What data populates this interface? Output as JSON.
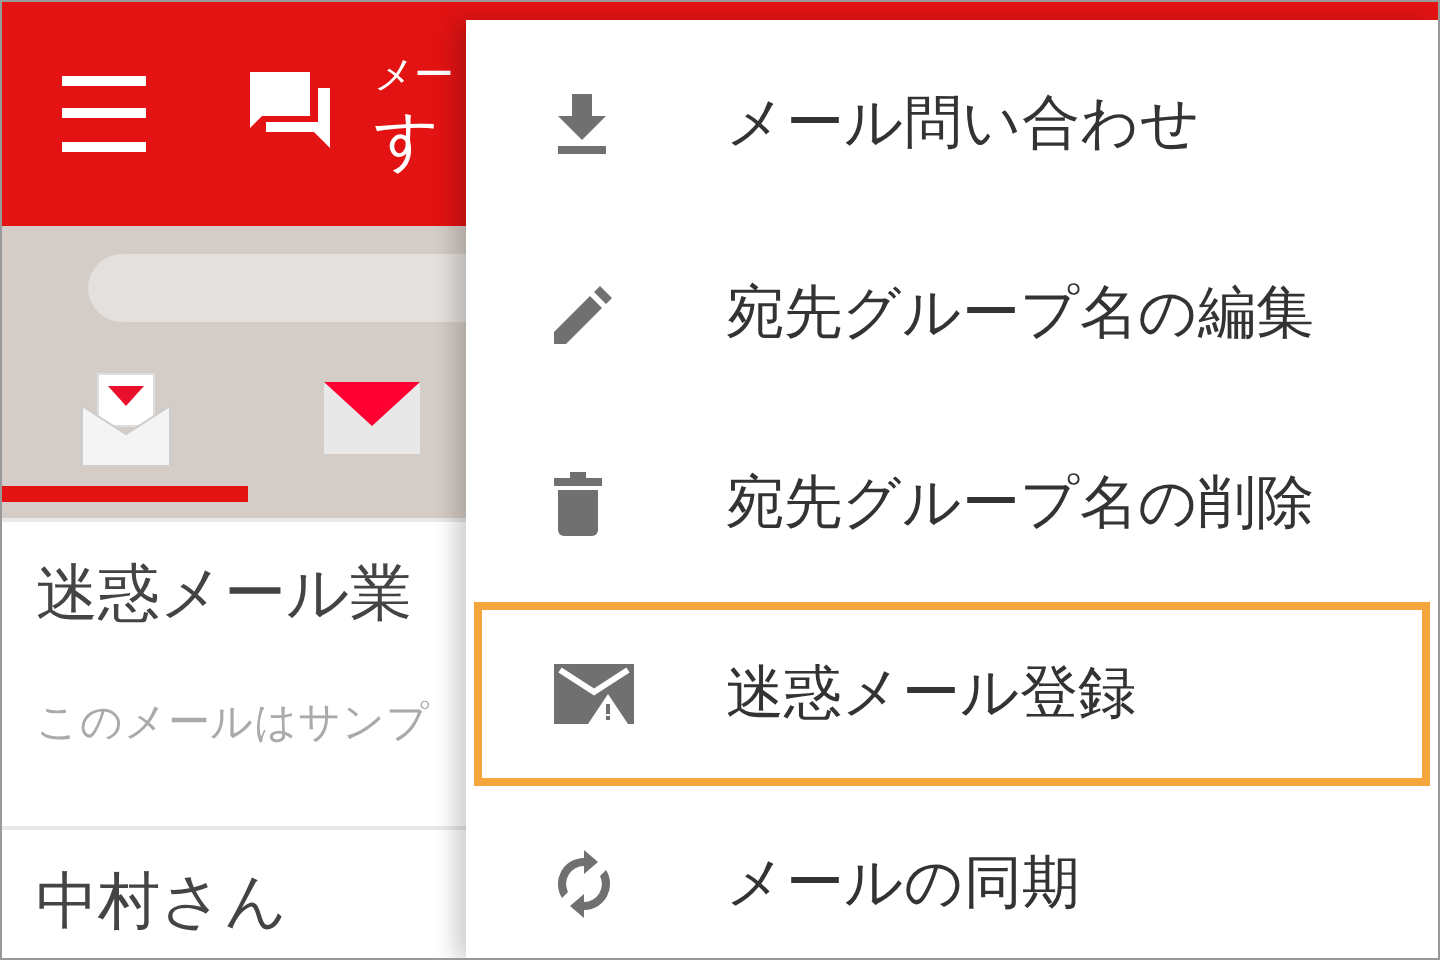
{
  "header": {
    "subtitle": "メー",
    "title": "す"
  },
  "tabs": [
    {
      "kind": "ymobile",
      "selected": true
    },
    {
      "kind": "mail",
      "selected": false
    }
  ],
  "messages": [
    {
      "sender": "迷惑メール業",
      "preview": "このメールはサンプ"
    },
    {
      "sender": "中村さん"
    }
  ],
  "menu": [
    {
      "kind": "download",
      "label": "メール問い合わせ",
      "selected": false
    },
    {
      "kind": "pencil",
      "label": "宛先グループ名の編集",
      "selected": false
    },
    {
      "kind": "trash",
      "label": "宛先グループ名の削除",
      "selected": false
    },
    {
      "kind": "spam",
      "label": "迷惑メール登録",
      "selected": true
    },
    {
      "kind": "sync",
      "label": "メールの同期",
      "selected": false
    }
  ]
}
